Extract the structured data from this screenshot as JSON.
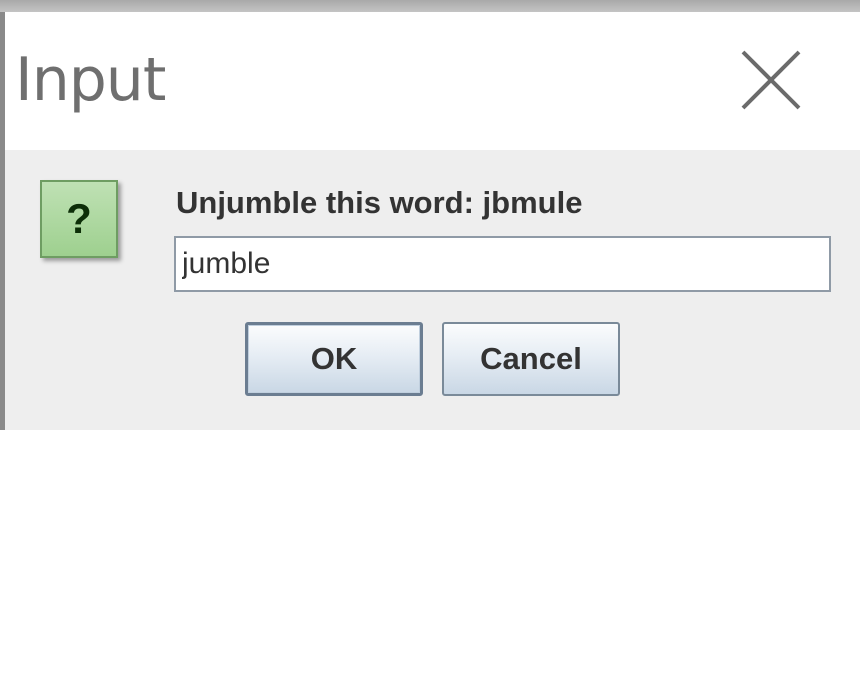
{
  "window": {
    "title": "Input",
    "close_icon": "close-x-icon"
  },
  "dialog": {
    "icon": "question-icon",
    "icon_glyph": "?",
    "message": "Unjumble this word: jbmule",
    "input": {
      "value": "jumble",
      "placeholder": ""
    },
    "buttons": {
      "ok_label": "OK",
      "cancel_label": "Cancel"
    }
  },
  "colors": {
    "title_text": "#6f6f6f",
    "content_bg": "#eeeeee",
    "icon_bg": "#a9d69b",
    "icon_border": "#6e9d62",
    "button_border": "#7a8a99"
  }
}
